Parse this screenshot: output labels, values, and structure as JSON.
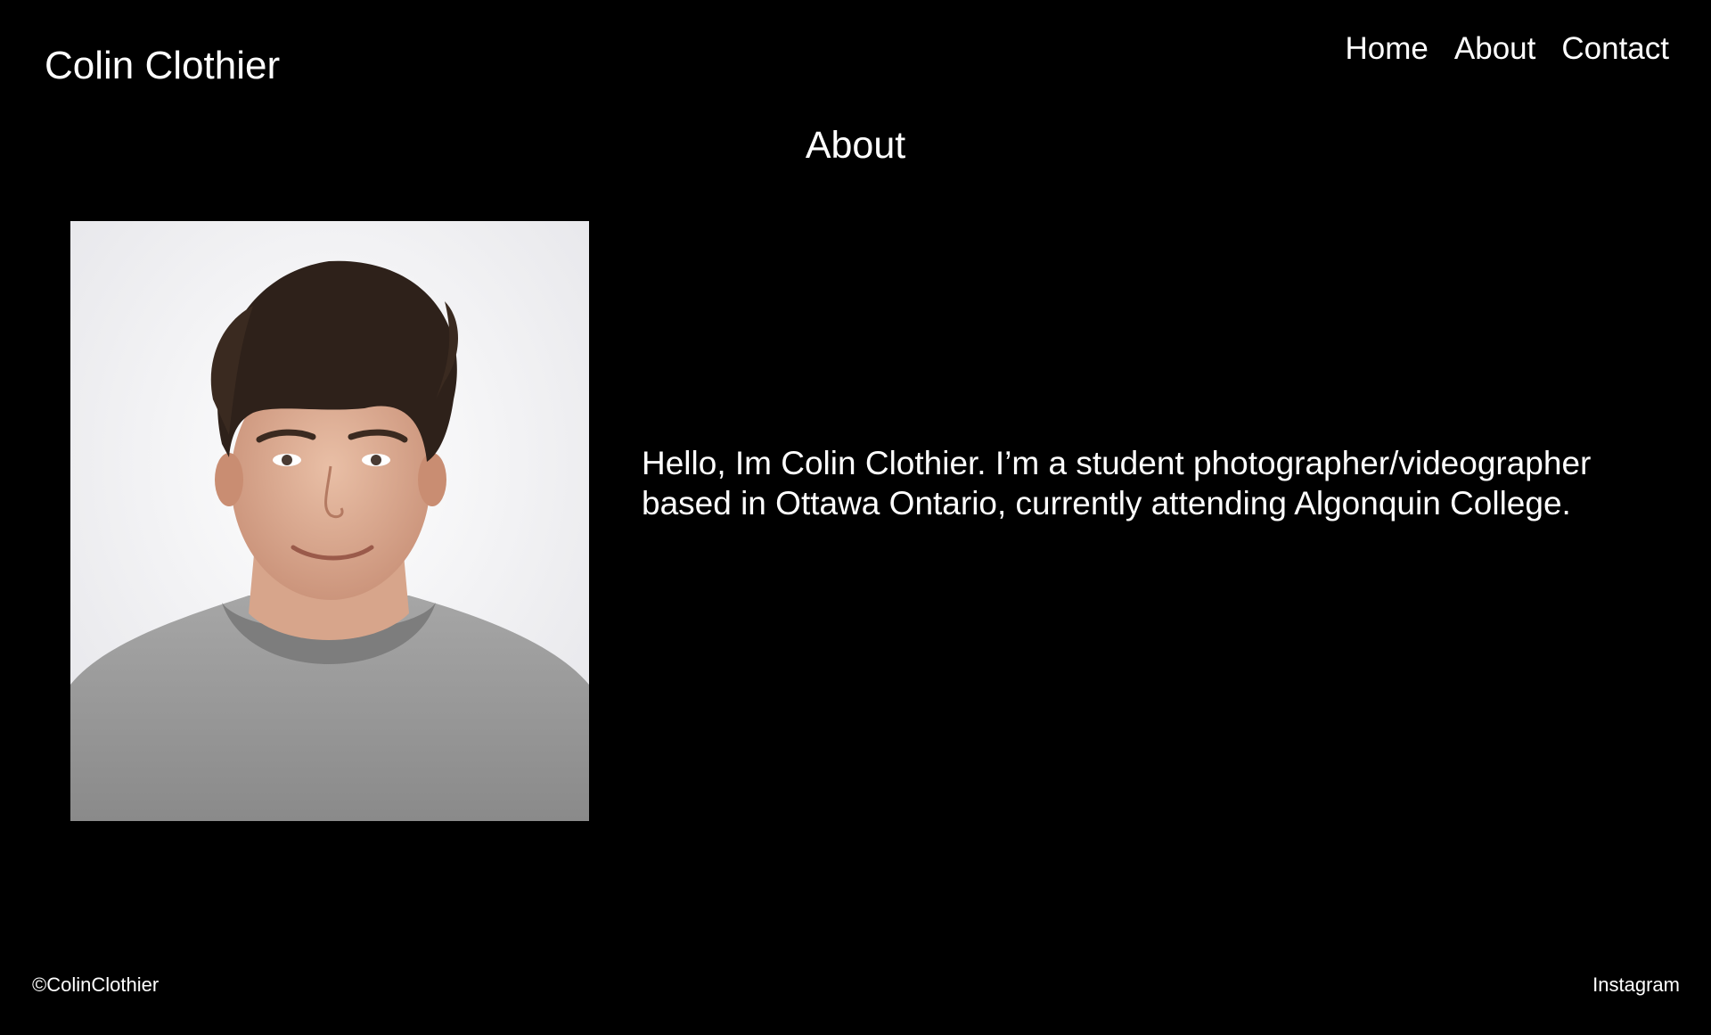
{
  "header": {
    "site_title": "Colin Clothier",
    "nav": [
      {
        "label": "Home"
      },
      {
        "label": "About"
      },
      {
        "label": "Contact"
      }
    ]
  },
  "main": {
    "heading": "About",
    "portrait_alt": "Portrait photo",
    "bio": "Hello, Im Colin Clothier. I’m a student photographer/videographer based in Ottawa Ontario, currently attending Algonquin College."
  },
  "footer": {
    "copyright": "©ColinClothier",
    "social_link": "Instagram"
  },
  "colors": {
    "background": "#000000",
    "text": "#ffffff"
  }
}
